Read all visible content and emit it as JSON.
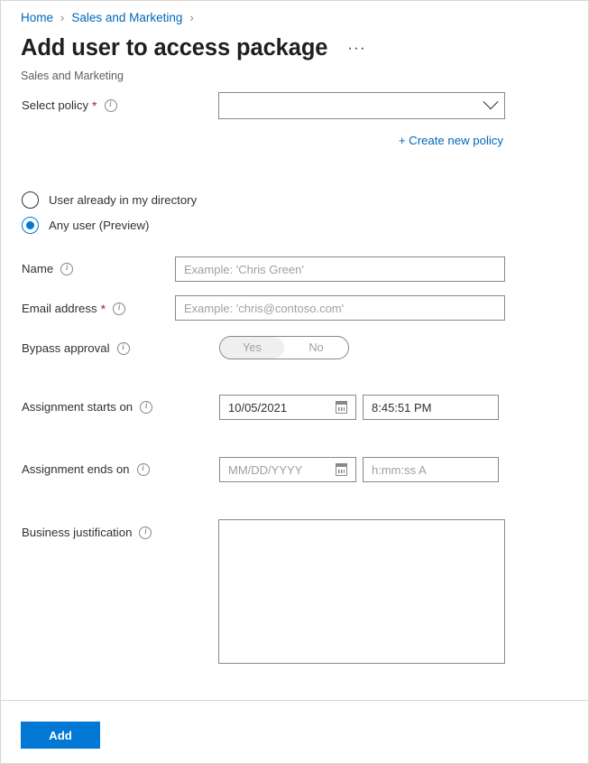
{
  "breadcrumb": {
    "items": [
      {
        "label": "Home"
      },
      {
        "label": "Sales and Marketing"
      }
    ],
    "separator": "›"
  },
  "header": {
    "title": "Add user to access package",
    "overflow_menu": "···",
    "subtitle": "Sales and Marketing"
  },
  "form": {
    "select_policy": {
      "label": "Select policy",
      "required_marker": "*",
      "info": "i",
      "value": "",
      "placeholder": ""
    },
    "create_new_policy_link": "+ Create new policy",
    "user_scope": {
      "options": [
        {
          "label": "User already in my directory",
          "selected": false
        },
        {
          "label": "Any user (Preview)",
          "selected": true
        }
      ]
    },
    "name": {
      "label": "Name",
      "info": "i",
      "value": "",
      "placeholder": "Example: 'Chris Green'"
    },
    "email": {
      "label": "Email address",
      "required_marker": "*",
      "info": "i",
      "value": "",
      "placeholder": "Example: 'chris@contoso.com'"
    },
    "bypass_approval": {
      "label": "Bypass approval",
      "info": "i",
      "options": [
        "Yes",
        "No"
      ],
      "selected": "Yes"
    },
    "assignment_starts": {
      "label": "Assignment starts on",
      "info": "i",
      "date_value": "10/05/2021",
      "time_value": "8:45:51 PM"
    },
    "assignment_ends": {
      "label": "Assignment ends on",
      "info": "i",
      "date_placeholder": "MM/DD/YYYY",
      "time_placeholder": "h:mm:ss A"
    },
    "business_justification": {
      "label": "Business justification",
      "info": "i",
      "value": ""
    }
  },
  "footer": {
    "add_label": "Add"
  },
  "colors": {
    "accent": "#0078d4",
    "link": "#0067b8",
    "required": "#a4262c",
    "border": "#8a8886",
    "text": "#323130",
    "muted": "#605e5c",
    "placeholder": "#a19f9d"
  }
}
